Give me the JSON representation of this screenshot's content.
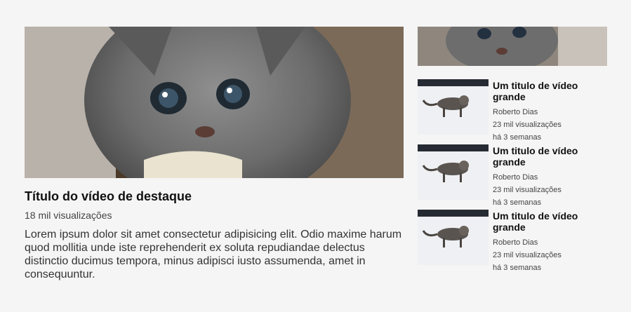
{
  "featured": {
    "title": "Título do vídeo de destaque",
    "views": "18 mil visualizações",
    "description": "Lorem ipsum dolor sit amet consectetur adipisicing elit. Odio maxime harum quod mollitia unde iste reprehenderit ex soluta repudiandae delectus distinctio ducimus tempora, minus adipisci iusto assumenda, amet in consequuntur."
  },
  "sidebar": {
    "videos": [
      {
        "title": "Um titulo de vídeo grande",
        "author": "Roberto Dias",
        "views": "23 mil visualizações",
        "age": "há 3 semanas"
      },
      {
        "title": "Um titulo de vídeo grande",
        "author": "Roberto Dias",
        "views": "23 mil visualizações",
        "age": "há 3 semanas"
      },
      {
        "title": "Um titulo de vídeo grande",
        "author": "Roberto Dias",
        "views": "23 mil visualizações",
        "age": "há 3 semanas"
      }
    ]
  }
}
